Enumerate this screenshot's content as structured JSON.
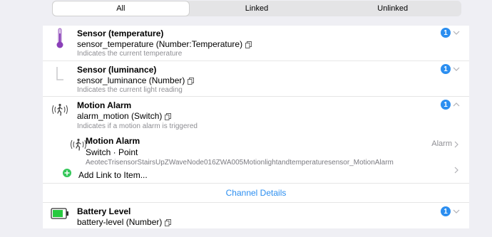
{
  "tabs": [
    {
      "label": "All",
      "active": true
    },
    {
      "label": "Linked",
      "active": false
    },
    {
      "label": "Unlinked",
      "active": false
    }
  ],
  "channels": {
    "temperature": {
      "title": "Sensor (temperature)",
      "id_type": "sensor_temperature (Number:Temperature)",
      "description": "Indicates the current temperature",
      "badge": "1",
      "icon": "thermometer-icon"
    },
    "luminance": {
      "title": "Sensor (luminance)",
      "id_type": "sensor_luminance (Number)",
      "description": "Indicates the current light reading",
      "badge": "1",
      "icon": "luminance-icon"
    },
    "motion": {
      "title": "Motion Alarm",
      "id_type": "alarm_motion (Switch)",
      "description": "Indicates if a motion alarm is triggered",
      "badge": "1",
      "icon": "motion-icon",
      "expanded": true,
      "linked_item": {
        "title": "Motion Alarm",
        "type_line": "Switch · Point",
        "item_name": "AeotecTrisensorStairsUpZWaveNode016ZWA005Motionlightandtemperaturesensor_MotionAlarm",
        "tag": "Alarm"
      },
      "add_link_label": "Add Link to Item...",
      "details_label": "Channel Details"
    },
    "battery": {
      "title": "Battery Level",
      "id_type": "battery-level (Number)",
      "badge": "1",
      "icon": "battery-icon"
    }
  },
  "colors": {
    "accent": "#2b8ef0",
    "add_green": "#34c759",
    "battery_green": "#27c93f",
    "thermo_purple": "#8a3fb8"
  }
}
